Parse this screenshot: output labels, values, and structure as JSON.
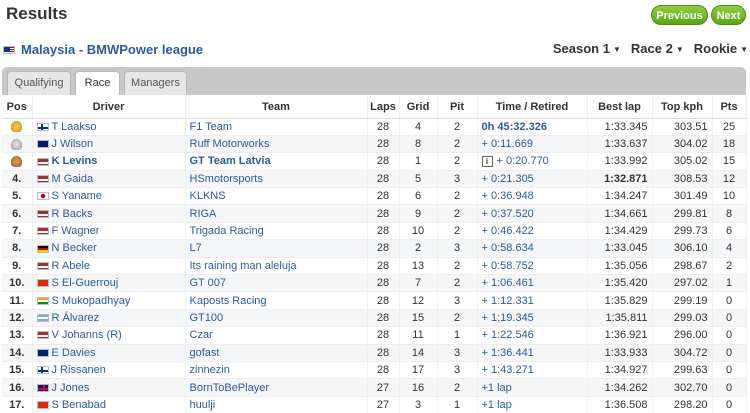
{
  "header": {
    "title": "Results",
    "prev_label": "Previous",
    "next_label": "Next"
  },
  "league": {
    "name": "Malaysia - BMWPower league",
    "flag": "malaysia"
  },
  "selectors": [
    {
      "label": "Season 1"
    },
    {
      "label": "Race 2"
    },
    {
      "label": "Rookie"
    }
  ],
  "tabs": [
    {
      "label": "Qualifying"
    },
    {
      "label": "Race"
    },
    {
      "label": "Managers"
    }
  ],
  "columns": {
    "pos": "Pos",
    "driver": "Driver",
    "team": "Team",
    "laps": "Laps",
    "grid": "Grid",
    "pit": "Pit",
    "time": "Time / Retired",
    "best": "Best lap",
    "kph": "Top kph",
    "pts": "Pts"
  },
  "rows": [
    {
      "pos": "",
      "trophy": "gold",
      "flag": "finland",
      "driver": "T Laakso",
      "team": "F1 Team",
      "laps": "28",
      "grid": "4",
      "pit": "2",
      "time": "0h 45:32.326",
      "best": "1:33.345",
      "kph": "303.51",
      "pts": "25",
      "time_bold": true
    },
    {
      "pos": "",
      "trophy": "silver",
      "flag": "newzealand",
      "driver": "J Wilson",
      "team": "Ruff Motorworks",
      "laps": "28",
      "grid": "8",
      "pit": "2",
      "time": "+ 0:11.669",
      "best": "1:33.637",
      "kph": "304.02",
      "pts": "18"
    },
    {
      "pos": "",
      "trophy": "bronze",
      "flag": "latvia",
      "driver": "K Levins",
      "team": "GT Team Latvia",
      "laps": "28",
      "grid": "1",
      "pit": "2",
      "time": "+ 0:20.770",
      "best": "1:33.992",
      "kph": "305.02",
      "pts": "15",
      "bold": true,
      "info": true
    },
    {
      "pos": "4.",
      "flag": "latvia",
      "driver": "M Gaida",
      "team": "HSmotorsports",
      "laps": "28",
      "grid": "5",
      "pit": "3",
      "time": "+ 0:21.305",
      "best": "1:32.871",
      "kph": "308.53",
      "pts": "12",
      "best_bold": true
    },
    {
      "pos": "5.",
      "flag": "japan",
      "driver": "S Yaname",
      "team": "KLKNS",
      "laps": "28",
      "grid": "6",
      "pit": "2",
      "time": "+ 0:36.948",
      "best": "1:34.247",
      "kph": "301.49",
      "pts": "10"
    },
    {
      "pos": "6.",
      "flag": "latvia",
      "driver": "R Backs",
      "team": "RIGA",
      "laps": "28",
      "grid": "9",
      "pit": "2",
      "time": "+ 0:37.520",
      "best": "1:34.661",
      "kph": "299.81",
      "pts": "8"
    },
    {
      "pos": "7.",
      "flag": "latvia",
      "driver": "F Wagner",
      "team": "Trigada Racing",
      "laps": "28",
      "grid": "10",
      "pit": "2",
      "time": "+ 0:46.422",
      "best": "1:34.429",
      "kph": "299.73",
      "pts": "6"
    },
    {
      "pos": "8.",
      "flag": "germany",
      "driver": "N Becker",
      "team": "L7",
      "laps": "28",
      "grid": "2",
      "pit": "3",
      "time": "+ 0:58.634",
      "best": "1:33.045",
      "kph": "306.10",
      "pts": "4"
    },
    {
      "pos": "9.",
      "flag": "latvia",
      "driver": "R Abele",
      "team": "Its raining man aleluja",
      "laps": "28",
      "grid": "13",
      "pit": "2",
      "time": "+ 0:58.752",
      "best": "1:35.056",
      "kph": "298.67",
      "pts": "2"
    },
    {
      "pos": "10.",
      "flag": "china",
      "driver": "S El-Guerrouj",
      "team": "GT 007",
      "laps": "28",
      "grid": "7",
      "pit": "2",
      "time": "+ 1:06.461",
      "best": "1:35.420",
      "kph": "297.02",
      "pts": "1"
    },
    {
      "pos": "11.",
      "flag": "india",
      "driver": "S Mukopadhyay",
      "team": "Kaposts Racing",
      "laps": "28",
      "grid": "12",
      "pit": "3",
      "time": "+ 1:12.331",
      "best": "1:35.829",
      "kph": "299.19",
      "pts": "0"
    },
    {
      "pos": "12.",
      "flag": "argentina",
      "driver": "R Álvarez",
      "team": "GT100",
      "laps": "28",
      "grid": "15",
      "pit": "2",
      "time": "+ 1:19.345",
      "best": "1:35.811",
      "kph": "299.03",
      "pts": "0"
    },
    {
      "pos": "13.",
      "flag": "latvia",
      "driver": "V Johanns (R)",
      "team": "Czar",
      "laps": "28",
      "grid": "11",
      "pit": "1",
      "time": "+ 1:22.546",
      "best": "1:36.921",
      "kph": "296.00",
      "pts": "0"
    },
    {
      "pos": "14.",
      "flag": "newzealand",
      "driver": "E Davies",
      "team": "gofast",
      "laps": "28",
      "grid": "14",
      "pit": "3",
      "time": "+ 1:36.441",
      "best": "1:33.933",
      "kph": "304.72",
      "pts": "0"
    },
    {
      "pos": "15.",
      "flag": "finland",
      "driver": "J Rissanen",
      "team": "zinnezin",
      "laps": "28",
      "grid": "17",
      "pit": "3",
      "time": "+ 1:43.271",
      "best": "1:34.927",
      "kph": "299.63",
      "pts": "0"
    },
    {
      "pos": "16.",
      "flag": "uk",
      "driver": "J Jones",
      "team": "BornToBePlayer",
      "laps": "27",
      "grid": "16",
      "pit": "2",
      "time": "+1 lap",
      "best": "1:34.262",
      "kph": "302.70",
      "pts": "0"
    },
    {
      "pos": "17.",
      "flag": "china",
      "driver": "S Benabad",
      "team": "huulji",
      "laps": "27",
      "grid": "3",
      "pit": "1",
      "time": "+1 lap",
      "best": "1:36.508",
      "kph": "298.20",
      "pts": "0"
    }
  ],
  "colors": {
    "link": "#2a5c9a",
    "button": "#6bb324"
  }
}
